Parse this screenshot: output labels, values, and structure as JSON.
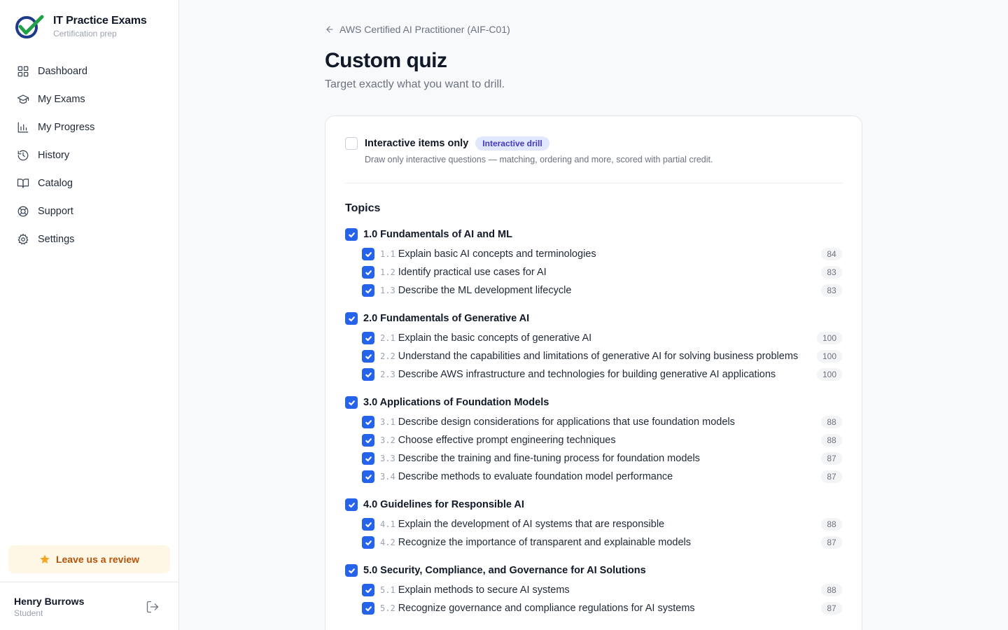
{
  "brand": {
    "title": "IT Practice Exams",
    "subtitle": "Certification prep"
  },
  "nav": [
    {
      "label": "Dashboard",
      "icon": "dashboard-icon"
    },
    {
      "label": "My Exams",
      "icon": "graduation-cap-icon"
    },
    {
      "label": "My Progress",
      "icon": "bar-chart-icon"
    },
    {
      "label": "History",
      "icon": "history-icon"
    },
    {
      "label": "Catalog",
      "icon": "book-open-icon"
    },
    {
      "label": "Support",
      "icon": "lifebuoy-icon"
    },
    {
      "label": "Settings",
      "icon": "gear-icon"
    }
  ],
  "review": {
    "label": "Leave us a review",
    "icon": "star-icon"
  },
  "user": {
    "name": "Henry Burrows",
    "role": "Student"
  },
  "breadcrumb": {
    "label": "AWS Certified AI Practitioner (AIF-C01)"
  },
  "page": {
    "title": "Custom quiz",
    "subtitle": "Target exactly what you want to drill."
  },
  "interactive": {
    "label": "Interactive items only",
    "badge": "Interactive drill",
    "description": "Draw only interactive questions — matching, ordering and more, scored with partial credit.",
    "checked": false
  },
  "topics": {
    "title": "Topics",
    "domains": [
      {
        "label": "1.0 Fundamentals of AI and ML",
        "checked": true,
        "tasks": [
          {
            "num": "1.1",
            "label": "Explain basic AI concepts and terminologies",
            "count": "84",
            "checked": true
          },
          {
            "num": "1.2",
            "label": "Identify practical use cases for AI",
            "count": "83",
            "checked": true
          },
          {
            "num": "1.3",
            "label": "Describe the ML development lifecycle",
            "count": "83",
            "checked": true
          }
        ]
      },
      {
        "label": "2.0 Fundamentals of Generative AI",
        "checked": true,
        "tasks": [
          {
            "num": "2.1",
            "label": "Explain the basic concepts of generative AI",
            "count": "100",
            "checked": true
          },
          {
            "num": "2.2",
            "label": "Understand the capabilities and limitations of generative AI for solving business problems",
            "count": "100",
            "checked": true
          },
          {
            "num": "2.3",
            "label": "Describe AWS infrastructure and technologies for building generative AI applications",
            "count": "100",
            "checked": true
          }
        ]
      },
      {
        "label": "3.0 Applications of Foundation Models",
        "checked": true,
        "tasks": [
          {
            "num": "3.1",
            "label": "Describe design considerations for applications that use foundation models",
            "count": "88",
            "checked": true
          },
          {
            "num": "3.2",
            "label": "Choose effective prompt engineering techniques",
            "count": "88",
            "checked": true
          },
          {
            "num": "3.3",
            "label": "Describe the training and fine-tuning process for foundation models",
            "count": "87",
            "checked": true
          },
          {
            "num": "3.4",
            "label": "Describe methods to evaluate foundation model performance",
            "count": "87",
            "checked": true
          }
        ]
      },
      {
        "label": "4.0 Guidelines for Responsible AI",
        "checked": true,
        "tasks": [
          {
            "num": "4.1",
            "label": "Explain the development of AI systems that are responsible",
            "count": "88",
            "checked": true
          },
          {
            "num": "4.2",
            "label": "Recognize the importance of transparent and explainable models",
            "count": "87",
            "checked": true
          }
        ]
      },
      {
        "label": "5.0 Security, Compliance, and Governance for AI Solutions",
        "checked": true,
        "tasks": [
          {
            "num": "5.1",
            "label": "Explain methods to secure AI systems",
            "count": "88",
            "checked": true
          },
          {
            "num": "5.2",
            "label": "Recognize governance and compliance regulations for AI systems",
            "count": "87",
            "checked": true
          }
        ]
      }
    ]
  },
  "colors": {
    "accent": "#2563eb",
    "badge_bg": "#e0e7ff",
    "badge_text": "#4338ca",
    "review_bg": "#fef7e6",
    "review_text": "#b45309"
  }
}
